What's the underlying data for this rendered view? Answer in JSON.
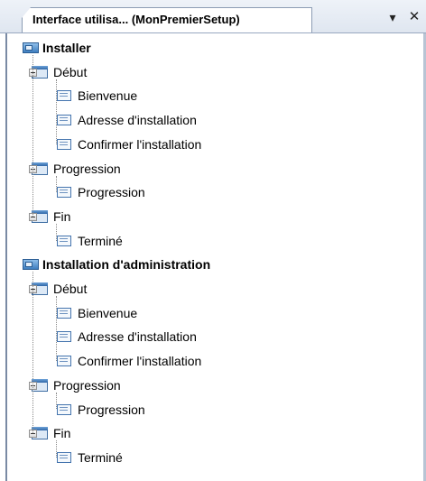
{
  "window": {
    "tab_title": "Interface utilisa... (MonPremierSetup)",
    "pin_glyph": "▾",
    "close_glyph": "✕"
  },
  "tree": {
    "roots": [
      {
        "label": "Installer",
        "groups": [
          {
            "label": "Début",
            "items": [
              "Bienvenue",
              "Adresse d'installation",
              "Confirmer l'installation"
            ]
          },
          {
            "label": "Progression",
            "items": [
              "Progression"
            ]
          },
          {
            "label": "Fin",
            "items": [
              "Terminé"
            ]
          }
        ]
      },
      {
        "label": "Installation d'administration",
        "groups": [
          {
            "label": "Début",
            "items": [
              "Bienvenue",
              "Adresse d'installation",
              "Confirmer l'installation"
            ]
          },
          {
            "label": "Progression",
            "items": [
              "Progression"
            ]
          },
          {
            "label": "Fin",
            "items": [
              "Terminé"
            ]
          }
        ]
      }
    ]
  }
}
